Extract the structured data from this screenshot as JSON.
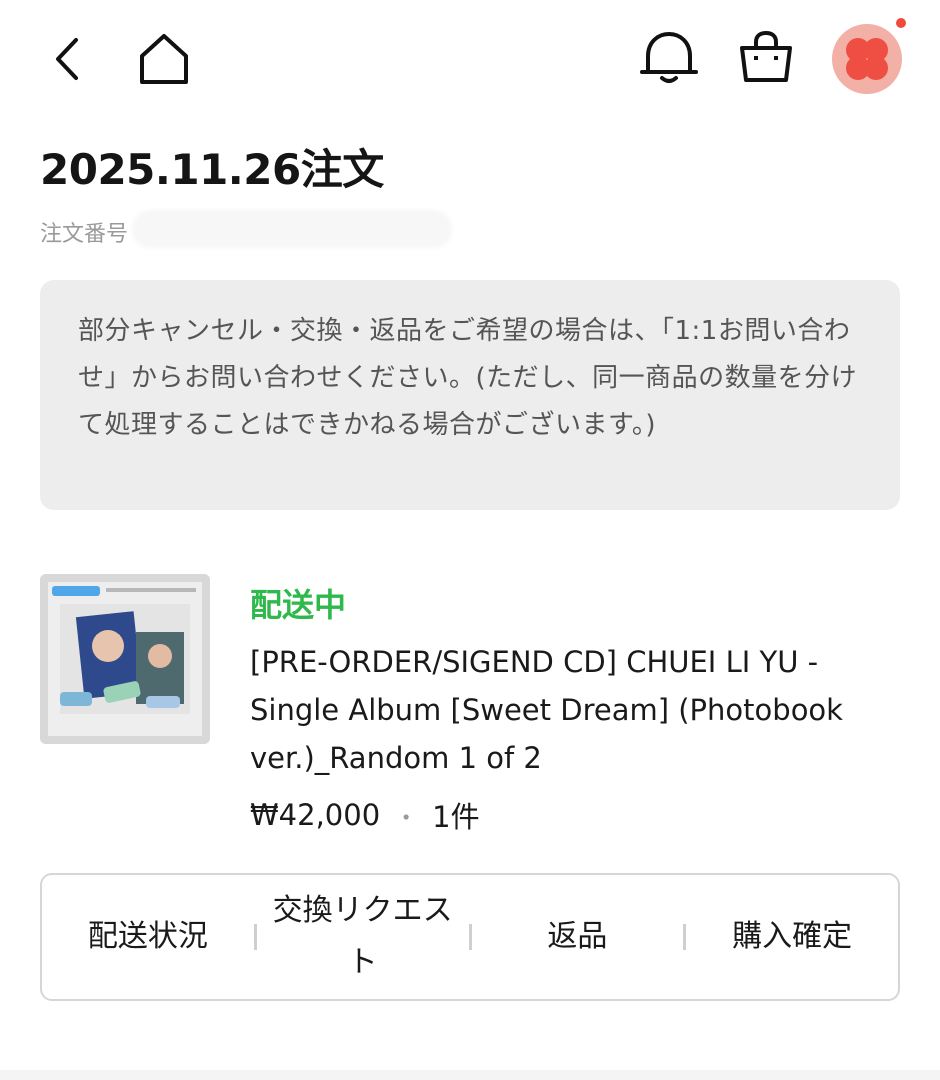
{
  "header": {
    "icons": [
      "back-icon",
      "home-icon",
      "bell-icon",
      "shopping-bag-icon",
      "avatar"
    ],
    "notification_dot_color": "#f04a3a"
  },
  "order": {
    "date_title": "2025.11.26注文",
    "number_label": "注文番号"
  },
  "notice": {
    "text": "部分キャンセル・交換・返品をご希望の場合は、「1:1お問い合わせ」からお問い合わせください。(ただし、同一商品の数量を分けて処理することはできかねる場合がございます。)"
  },
  "product": {
    "status": "配送中",
    "status_color": "#2fb84b",
    "title": "[PRE-ORDER/SIGEND CD] CHUEI LI YU - Single Album [Sweet Dream] (Photobook ver.)_Random 1 of 2",
    "price": "₩42,000",
    "separator": "・",
    "quantity": "1件"
  },
  "actions": {
    "delivery_status": "配送状況",
    "exchange_request": "交換リクエスト",
    "return": "返品",
    "confirm_purchase": "購入確定"
  }
}
